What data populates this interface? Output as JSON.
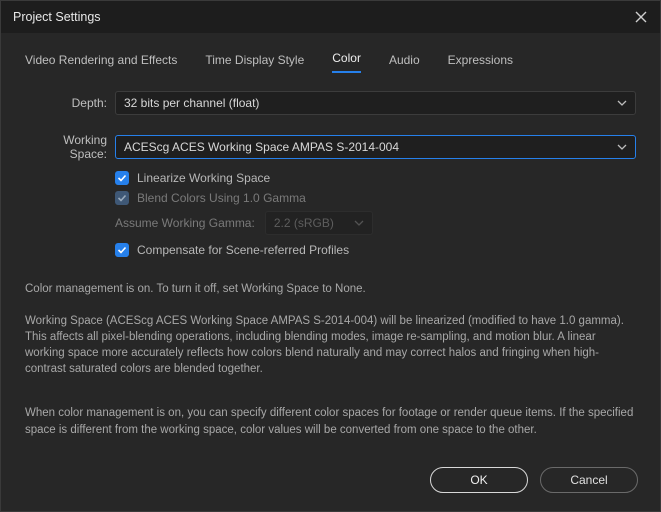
{
  "window": {
    "title": "Project Settings"
  },
  "tabs": {
    "t0": "Video Rendering and Effects",
    "t1": "Time Display Style",
    "t2": "Color",
    "t3": "Audio",
    "t4": "Expressions",
    "active": "Color"
  },
  "form": {
    "depth_label": "Depth:",
    "depth_value": "32 bits per channel (float)",
    "workingspace_label": "Working Space:",
    "workingspace_value": "ACEScg ACES Working Space AMPAS S-2014-004",
    "linearize_label": "Linearize Working Space",
    "linearize_checked": true,
    "blend_label": "Blend Colors Using 1.0 Gamma",
    "blend_checked": true,
    "assume_label": "Assume Working Gamma:",
    "assume_value": "2.2 (sRGB)",
    "compensate_label": "Compensate for Scene-referred Profiles",
    "compensate_checked": true
  },
  "info": {
    "line1": "Color management is on. To turn it off, set Working Space to None.",
    "para1": "Working Space (ACEScg ACES Working Space AMPAS S-2014-004) will be linearized (modified to have 1.0 gamma). This affects all pixel-blending operations, including blending modes, image re-sampling, and motion blur. A linear working space more accurately reflects how colors blend naturally and may correct halos and fringing when high-contrast saturated colors are blended together.",
    "para2": "When color management is on, you can specify different color spaces for footage or render queue items. If the specified space is different from the working space, color values will be converted from one space to the other."
  },
  "buttons": {
    "ok": "OK",
    "cancel": "Cancel"
  },
  "colors": {
    "accent": "#2680eb"
  }
}
